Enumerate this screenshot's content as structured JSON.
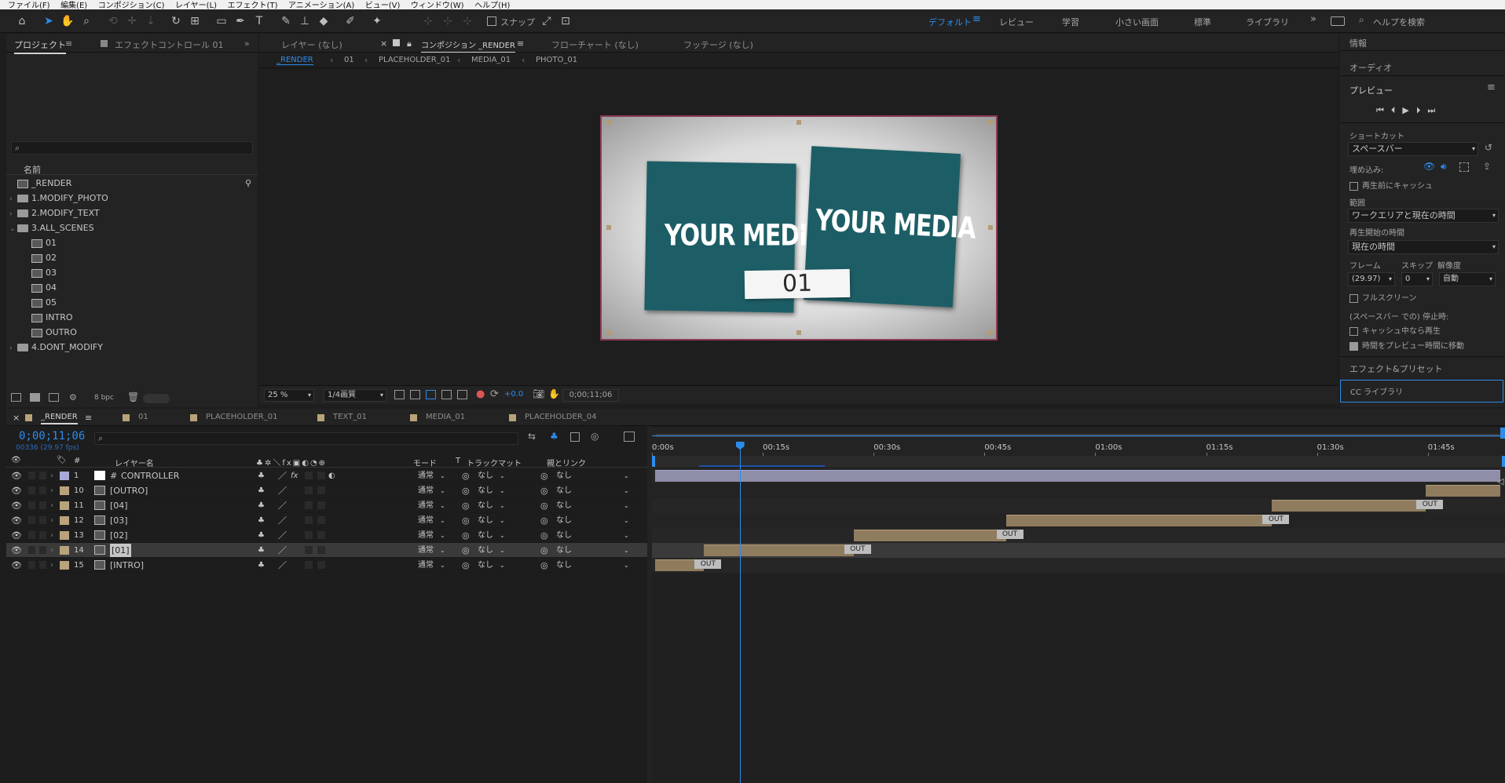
{
  "menu": [
    "ファイル(F)",
    "編集(E)",
    "コンポジション(C)",
    "レイヤー(L)",
    "エフェクト(T)",
    "アニメーション(A)",
    "ビュー(V)",
    "ウィンドウ(W)",
    "ヘルプ(H)"
  ],
  "toolbar": {
    "snap_label": "スナップ",
    "workspaces": [
      "デフォルト",
      "レビュー",
      "学習",
      "小さい画面",
      "標準",
      "ライブラリ"
    ],
    "help_placeholder": "ヘルプを検索"
  },
  "project": {
    "tabs": [
      "プロジェクト",
      "エフェクトコントロール 01"
    ],
    "col_name": "名前",
    "items": [
      {
        "label": "_RENDER",
        "type": "comp",
        "indent": 0
      },
      {
        "label": "1.MODIFY_PHOTO",
        "type": "folder",
        "indent": 0
      },
      {
        "label": "2.MODIFY_TEXT",
        "type": "folder",
        "indent": 0
      },
      {
        "label": "3.ALL_SCENES",
        "type": "folder",
        "indent": 0,
        "open": true
      },
      {
        "label": "01",
        "type": "comp",
        "indent": 1
      },
      {
        "label": "02",
        "type": "comp",
        "indent": 1
      },
      {
        "label": "03",
        "type": "comp",
        "indent": 1
      },
      {
        "label": "04",
        "type": "comp",
        "indent": 1
      },
      {
        "label": "05",
        "type": "comp",
        "indent": 1
      },
      {
        "label": "INTRO",
        "type": "comp",
        "indent": 1
      },
      {
        "label": "OUTRO",
        "type": "comp",
        "indent": 1
      },
      {
        "label": "4.DONT_MODIFY",
        "type": "folder",
        "indent": 0
      }
    ],
    "bpc": "8 bpc"
  },
  "viewer": {
    "tabs": [
      "レイヤー (なし)",
      "コンポジション _RENDER",
      "フローチャート (なし)",
      "フッテージ (なし)"
    ],
    "breadcrumbs": [
      "_RENDER",
      "01",
      "PLACEHOLDER_01",
      "MEDIA_01",
      "PHOTO_01"
    ],
    "card_text_1": "YOUR MEDIA",
    "card_text_2": "YOUR MEDIA",
    "label_num": "01",
    "zoom": "25 %",
    "quality": "1/4画質",
    "exposure": "+0.0",
    "timecode": "0;00;11;06"
  },
  "right": {
    "info": "情報",
    "audio": "オーディオ",
    "preview": "プレビュー",
    "shortcut": "ショートカット",
    "shortcut_val": "スペースバー",
    "embed": "埋め込み:",
    "cache_before": "再生前にキャッシュ",
    "range": "範囲",
    "range_val": "ワークエリアと現在の時間",
    "start": "再生開始の時間",
    "start_val": "現在の時間",
    "frame": "フレーム",
    "skip": "スキップ",
    "res": "解像度",
    "frame_val": "(29.97)",
    "skip_val": "0",
    "res_val": "自動",
    "fullscreen": "フルスクリーン",
    "stop_on": "(スペースバー での) 停止時:",
    "if_cache": "キャッシュ中なら再生",
    "move_time": "時間をプレビュー時間に移動",
    "effects": "エフェクト&プリセット",
    "cclib": "CC ライブラリ"
  },
  "timeline": {
    "tabs": [
      "_RENDER",
      "01",
      "PLACEHOLDER_01",
      "TEXT_01",
      "MEDIA_01",
      "PLACEHOLDER_04"
    ],
    "timecode": "0;00;11;06",
    "fps": "00336 (29.97 fps)",
    "cols": {
      "num": "#",
      "name": "レイヤー名",
      "mode": "モード",
      "t": "T",
      "track": "トラックマット",
      "parent": "親とリンク"
    },
    "ruler": [
      "0:00s",
      "00:15s",
      "00:30s",
      "00:45s",
      "01:00s",
      "01:15s",
      "01:30s",
      "01:45s"
    ],
    "playhead": 0.1,
    "layers": [
      {
        "num": "1",
        "name": "CONTROLLER",
        "mode": "通常",
        "track": "なし",
        "parent": "なし",
        "color": "#a8a8d8",
        "start": 0,
        "end": 1,
        "null": true
      },
      {
        "num": "10",
        "name": "[OUTRO]",
        "mode": "通常",
        "track": "なし",
        "parent": "なし",
        "color": "#b9a37a",
        "start": 0.912,
        "end": 1,
        "out": ""
      },
      {
        "num": "11",
        "name": "[04]",
        "mode": "通常",
        "track": "なし",
        "parent": "なし",
        "color": "#b9a37a",
        "start": 0.73,
        "end": 0.912,
        "out": "OUT"
      },
      {
        "num": "12",
        "name": "[03]",
        "mode": "通常",
        "track": "なし",
        "parent": "なし",
        "color": "#b9a37a",
        "start": 0.415,
        "end": 0.73,
        "out": "OUT"
      },
      {
        "num": "13",
        "name": "[02]",
        "mode": "通常",
        "track": "なし",
        "parent": "なし",
        "color": "#b9a37a",
        "start": 0.235,
        "end": 0.415,
        "out": "OUT"
      },
      {
        "num": "14",
        "name": "[01]",
        "mode": "通常",
        "track": "なし",
        "parent": "なし",
        "color": "#b9a37a",
        "start": 0.058,
        "end": 0.235,
        "out": "OUT",
        "selected": true
      },
      {
        "num": "15",
        "name": "[INTRO]",
        "mode": "通常",
        "track": "なし",
        "parent": "なし",
        "color": "#b9a37a",
        "start": 0,
        "end": 0.058,
        "out": "OUT"
      }
    ]
  }
}
